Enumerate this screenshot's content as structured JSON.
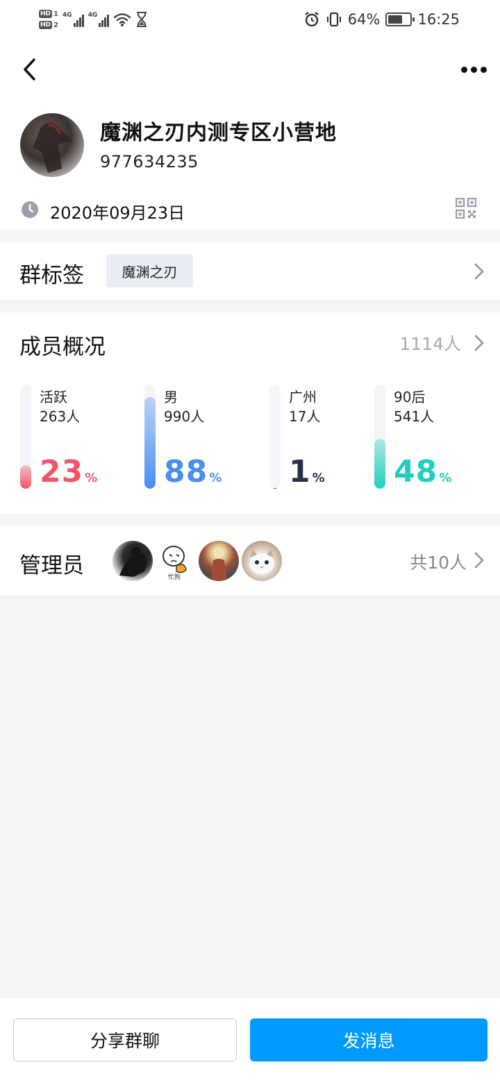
{
  "status_bar": {
    "sim1_badge": "HD",
    "sim1_num": "1",
    "sim2_badge": "HD",
    "sim2_num": "2",
    "net1": "4G",
    "net2": "4G",
    "battery_percent": "64%",
    "battery_level": 0.64,
    "time": "16:25",
    "icons": [
      "wifi-icon",
      "hourglass-icon",
      "alarm-icon",
      "vibrate-icon",
      "battery-icon"
    ]
  },
  "header": {
    "group_name": "魔渊之刃内测专区小营地",
    "group_id": "977634235",
    "create_date": "2020年09月23日"
  },
  "tags": {
    "title": "群标签",
    "items": [
      "魔渊之刃"
    ]
  },
  "members": {
    "title": "成员概况",
    "total": "1114人",
    "stats": [
      {
        "label": "活跃",
        "count": "263人",
        "percent": "23",
        "unit": "%",
        "value": 23,
        "color": "#f0566b"
      },
      {
        "label": "男",
        "count": "990人",
        "percent": "88",
        "unit": "%",
        "value": 88,
        "color": "#4a8ef0"
      },
      {
        "label": "广州",
        "count": "17人",
        "percent": "1",
        "unit": "%",
        "value": 1,
        "color": "#27304a"
      },
      {
        "label": "90后",
        "count": "541人",
        "percent": "48",
        "unit": "%",
        "value": 48,
        "color": "#22cfbe"
      }
    ]
  },
  "admins": {
    "title": "管理员",
    "count": "共10人",
    "avatar_caption": "忙狗"
  },
  "actions": {
    "share_label": "分享群聊",
    "send_label": "发消息"
  }
}
